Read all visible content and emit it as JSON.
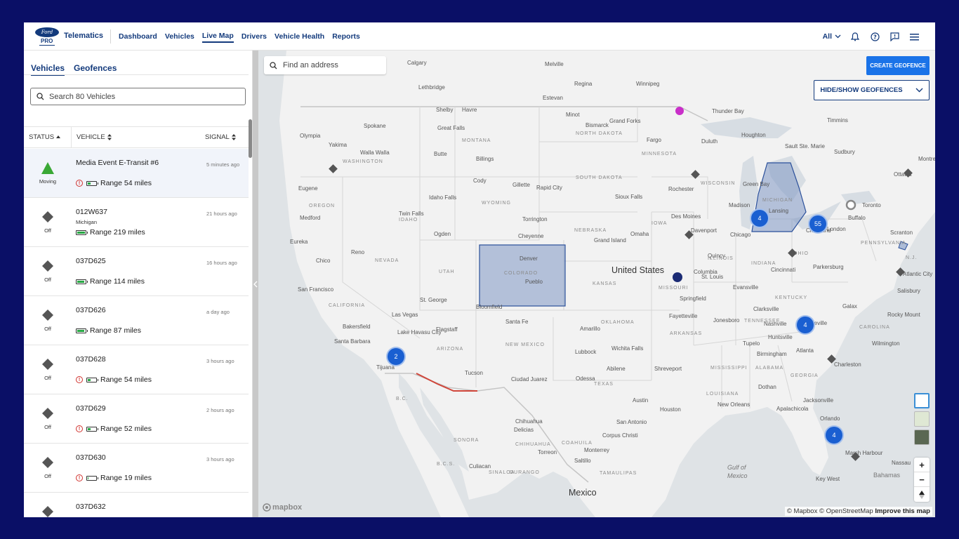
{
  "brand": {
    "logo_text": "Ford",
    "pro": "PRO",
    "app_name": "Telematics"
  },
  "nav": [
    {
      "label": "Dashboard"
    },
    {
      "label": "Vehicles"
    },
    {
      "label": "Live Map",
      "active": true
    },
    {
      "label": "Drivers"
    },
    {
      "label": "Vehicle Health"
    },
    {
      "label": "Reports"
    }
  ],
  "topright": {
    "filter_label": "All",
    "icons": [
      "bell-icon",
      "help-icon",
      "feedback-icon",
      "menu-icon"
    ]
  },
  "panel": {
    "tabs": [
      {
        "label": "Vehicles",
        "active": true
      },
      {
        "label": "Geofences"
      }
    ],
    "search_placeholder": "Search 80 Vehicles",
    "columns": {
      "status": "STATUS",
      "vehicle": "VEHICLE",
      "signal": "SIGNAL"
    },
    "vehicles": [
      {
        "name": "Media Event E-Transit #6",
        "location": "",
        "status": "Moving",
        "time": "5 minutes ago",
        "range": "Range 54 miles",
        "warning": true,
        "battery": 0.4
      },
      {
        "name": "012W637",
        "location": "Michigan",
        "status": "Off",
        "time": "21 hours ago",
        "range": "Range 219 miles",
        "warning": false,
        "battery": 1.0
      },
      {
        "name": "037D625",
        "location": "",
        "status": "Off",
        "time": "16 hours ago",
        "range": "Range 114 miles",
        "warning": false,
        "battery": 0.9
      },
      {
        "name": "037D626",
        "location": "",
        "status": "Off",
        "time": "a day ago",
        "range": "Range 87 miles",
        "warning": false,
        "battery": 0.9
      },
      {
        "name": "037D628",
        "location": "",
        "status": "Off",
        "time": "3 hours ago",
        "range": "Range 54 miles",
        "warning": true,
        "battery": 0.4
      },
      {
        "name": "037D629",
        "location": "",
        "status": "Off",
        "time": "2 hours ago",
        "range": "Range 52 miles",
        "warning": true,
        "battery": 0.4
      },
      {
        "name": "037D630",
        "location": "",
        "status": "Off",
        "time": "3 hours ago",
        "range": "Range 19 miles",
        "warning": true,
        "battery": 0.05
      },
      {
        "name": "037D632",
        "location": "",
        "status": "Off",
        "time": "",
        "range": "",
        "warning": false,
        "battery": 0
      }
    ]
  },
  "map": {
    "search_placeholder": "Find an address",
    "create_geofence": "CREATE GEOFENCE",
    "hide_show_geofences": "HIDE/SHOW GEOFENCES",
    "clusters": [
      {
        "count": "4",
        "where": "Chicago"
      },
      {
        "count": "55",
        "where": "Michigan"
      },
      {
        "count": "2",
        "where": "San Diego"
      },
      {
        "count": "4",
        "where": "Tennessee"
      },
      {
        "count": "4",
        "where": "Florida"
      }
    ],
    "labels": {
      "country_us": "United States",
      "country_mx": "Mexico",
      "gulf": "Gulf of Mexico",
      "bahamas": "Bahamas",
      "cities": [
        "Calgary",
        "Lethbridge",
        "Melville",
        "Regina",
        "Estevan",
        "Winnipeg",
        "Thunder Bay",
        "Shelby",
        "Havre",
        "Minot",
        "Grand Forks",
        "Great Falls",
        "Spokane",
        "Yakima",
        "Walla Walla",
        "Olympia",
        "Bismarck",
        "Fargo",
        "Duluth",
        "Houghton",
        "Sault Ste. Marie",
        "Timmins",
        "Sudbury",
        "Butte",
        "Billings",
        "Eugene",
        "Medford",
        "Twin Falls",
        "Idaho Falls",
        "Cody",
        "Gillette",
        "Rapid City",
        "Sioux Falls",
        "Rochester",
        "Madison",
        "Green Bay",
        "Lansing",
        "London",
        "Buffalo",
        "Toronto",
        "Ottawa",
        "Montreal",
        "Eureka",
        "Reno",
        "Ogden",
        "Cheyenne",
        "Torrington",
        "Denver",
        "Pueblo",
        "Omaha",
        "Grand Island",
        "Des Moines",
        "Davenport",
        "Chicago",
        "Cleveland",
        "Scranton",
        "Chico",
        "San Francisco",
        "Las Vegas",
        "St. George",
        "Bloomfield",
        "Columbia",
        "Springfield",
        "St. Louis",
        "Quincy",
        "Evansville",
        "Cincinnati",
        "Parkersburg",
        "Salisbury",
        "Atlantic City",
        "Bakersfield",
        "Lake Havasu City",
        "Flagstaff",
        "Santa Fe",
        "Amarillo",
        "Fayetteville",
        "Jonesboro",
        "Clarksville",
        "Nashville",
        "Asheville",
        "Galax",
        "Rocky Mount",
        "Santa Barbara",
        "Tijuana",
        "Tucson",
        "Ciudad Juarez",
        "Odessa",
        "Lubbock",
        "Wichita Falls",
        "Abilene",
        "Shreveport",
        "Tupelo",
        "Birmingham",
        "Huntsville",
        "Atlanta",
        "Charleston",
        "Wilmington",
        "Dothan",
        "Austin",
        "San Antonio",
        "Houston",
        "New Orleans",
        "Apalachicola",
        "Jacksonville",
        "Orlando",
        "Corpus Christi",
        "Chihuahua",
        "Delicias",
        "Saltillo",
        "Monterrey",
        "Torreon",
        "Culiacan",
        "Key West",
        "Marsh Harbour",
        "Nassau"
      ],
      "states": [
        "WASHINGTON",
        "MONTANA",
        "NORTH DAKOTA",
        "MINNESOTA",
        "MICHIGAN",
        "OREGON",
        "IDAHO",
        "WYOMING",
        "SOUTH DAKOTA",
        "WISCONSIN",
        "NEBRASKA",
        "IOWA",
        "ILLINOIS",
        "INDIANA",
        "OHIO",
        "PENNSYLVANIA",
        "NEVADA",
        "UTAH",
        "COLORADO",
        "KANSAS",
        "MISSOURI",
        "KENTUCKY",
        "CALIFORNIA",
        "ARIZONA",
        "NEW MEXICO",
        "OKLAHOMA",
        "ARKANSAS",
        "TENNESSEE",
        "TEXAS",
        "MISSISSIPPI",
        "ALABAMA",
        "GEORGIA",
        "LOUISIANA",
        "CHIHUAHUA",
        "COAHUILA",
        "SONORA",
        "B.C.",
        "B.C.S.",
        "SINALOA",
        "DURANGO",
        "TAMAULIPAS",
        "N.J.",
        "CAROLINA"
      ]
    },
    "attribution": {
      "mapbox": "© Mapbox",
      "osm": "© OpenStreetMap",
      "improve": "Improve this map"
    },
    "mapbox_logo": "mapbox"
  },
  "colors": {
    "brand_navy": "#133a7c",
    "accent_blue": "#1a73e8",
    "cluster_blue": "#1a5fd1",
    "geofence_fill": "#7f97c4",
    "warning_red": "#d0312d",
    "battery_green": "#27a844"
  }
}
